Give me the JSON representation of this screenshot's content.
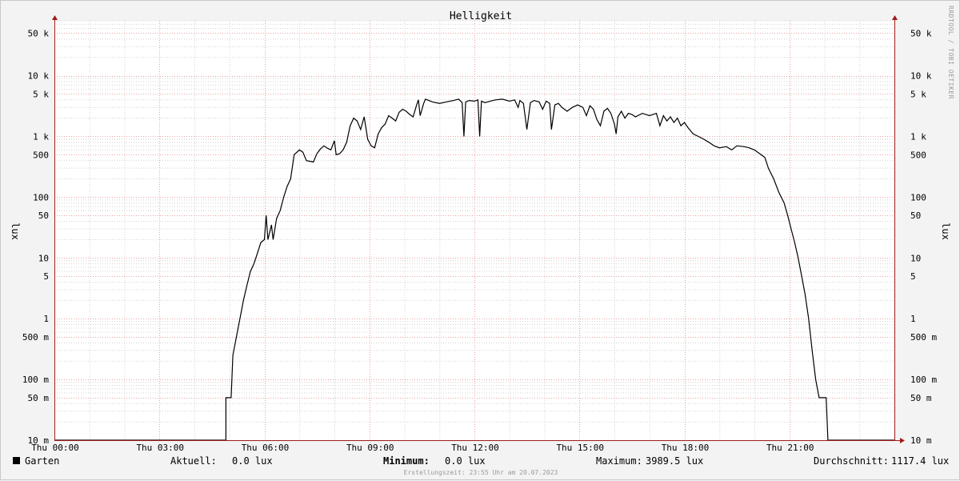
{
  "chart_data": {
    "type": "line",
    "title": "Helligkeit",
    "ylabel_left": "lux",
    "ylabel_right": "lux",
    "y_scale": "log",
    "ylim": [
      0.01,
      80000
    ],
    "xlim_hours": [
      0,
      24
    ],
    "x_ticks": [
      {
        "hour": 0,
        "label": "Thu 00:00"
      },
      {
        "hour": 3,
        "label": "Thu 03:00"
      },
      {
        "hour": 6,
        "label": "Thu 06:00"
      },
      {
        "hour": 9,
        "label": "Thu 09:00"
      },
      {
        "hour": 12,
        "label": "Thu 12:00"
      },
      {
        "hour": 15,
        "label": "Thu 15:00"
      },
      {
        "hour": 18,
        "label": "Thu 18:00"
      },
      {
        "hour": 21,
        "label": "Thu 21:00"
      }
    ],
    "y_ticks": [
      {
        "value": 0.01,
        "label": "10 m"
      },
      {
        "value": 0.05,
        "label": "50 m"
      },
      {
        "value": 0.1,
        "label": "100 m"
      },
      {
        "value": 0.5,
        "label": "500 m"
      },
      {
        "value": 1,
        "label": "1"
      },
      {
        "value": 5,
        "label": "5"
      },
      {
        "value": 10,
        "label": "10"
      },
      {
        "value": 50,
        "label": "50"
      },
      {
        "value": 100,
        "label": "100"
      },
      {
        "value": 500,
        "label": "500"
      },
      {
        "value": 1000,
        "label": "1 k"
      },
      {
        "value": 5000,
        "label": "5 k"
      },
      {
        "value": 10000,
        "label": "10 k"
      },
      {
        "value": 50000,
        "label": "50 k"
      }
    ],
    "grid": true,
    "colors": {
      "line": "#000000",
      "major_grid": "#e8a3a3",
      "minor_grid": "#d4d4d4",
      "axis": "#a11b1b",
      "plot_bg": "#ffffff"
    },
    "series": [
      {
        "name": "Garten",
        "points": [
          [
            0,
            0.01
          ],
          [
            4.9,
            0.01
          ],
          [
            4.9,
            0.05
          ],
          [
            5.05,
            0.05
          ],
          [
            5.1,
            0.25
          ],
          [
            5.2,
            0.5
          ],
          [
            5.3,
            1
          ],
          [
            5.4,
            2
          ],
          [
            5.5,
            3.5
          ],
          [
            5.6,
            6
          ],
          [
            5.7,
            8
          ],
          [
            5.8,
            12
          ],
          [
            5.9,
            18
          ],
          [
            6.0,
            20
          ],
          [
            6.05,
            50
          ],
          [
            6.1,
            20
          ],
          [
            6.2,
            35
          ],
          [
            6.25,
            20
          ],
          [
            6.35,
            45
          ],
          [
            6.45,
            60
          ],
          [
            6.55,
            100
          ],
          [
            6.65,
            150
          ],
          [
            6.75,
            200
          ],
          [
            6.85,
            500
          ],
          [
            7.0,
            600
          ],
          [
            7.1,
            550
          ],
          [
            7.2,
            400
          ],
          [
            7.4,
            380
          ],
          [
            7.5,
            520
          ],
          [
            7.6,
            620
          ],
          [
            7.7,
            700
          ],
          [
            7.8,
            640
          ],
          [
            7.9,
            600
          ],
          [
            8.0,
            850
          ],
          [
            8.05,
            500
          ],
          [
            8.15,
            520
          ],
          [
            8.25,
            600
          ],
          [
            8.35,
            800
          ],
          [
            8.45,
            1500
          ],
          [
            8.55,
            2000
          ],
          [
            8.65,
            1800
          ],
          [
            8.75,
            1300
          ],
          [
            8.85,
            2100
          ],
          [
            8.95,
            900
          ],
          [
            9.05,
            700
          ],
          [
            9.15,
            650
          ],
          [
            9.25,
            1100
          ],
          [
            9.35,
            1400
          ],
          [
            9.45,
            1600
          ],
          [
            9.55,
            2200
          ],
          [
            9.65,
            2000
          ],
          [
            9.75,
            1800
          ],
          [
            9.85,
            2500
          ],
          [
            9.95,
            2800
          ],
          [
            10.05,
            2600
          ],
          [
            10.15,
            2300
          ],
          [
            10.25,
            2100
          ],
          [
            10.35,
            3300
          ],
          [
            10.4,
            4000
          ],
          [
            10.45,
            2200
          ],
          [
            10.55,
            3500
          ],
          [
            10.6,
            4100
          ],
          [
            10.8,
            3700
          ],
          [
            11.0,
            3500
          ],
          [
            11.2,
            3700
          ],
          [
            11.4,
            3900
          ],
          [
            11.55,
            4100
          ],
          [
            11.65,
            3600
          ],
          [
            11.7,
            1000
          ],
          [
            11.75,
            3700
          ],
          [
            11.85,
            3900
          ],
          [
            12.0,
            3800
          ],
          [
            12.1,
            4000
          ],
          [
            12.15,
            1000
          ],
          [
            12.2,
            3800
          ],
          [
            12.3,
            3600
          ],
          [
            12.45,
            3800
          ],
          [
            12.6,
            4000
          ],
          [
            12.8,
            4100
          ],
          [
            13.0,
            3800
          ],
          [
            13.15,
            4000
          ],
          [
            13.25,
            3000
          ],
          [
            13.3,
            3900
          ],
          [
            13.4,
            3500
          ],
          [
            13.5,
            1300
          ],
          [
            13.6,
            3600
          ],
          [
            13.7,
            3900
          ],
          [
            13.85,
            3700
          ],
          [
            13.95,
            2800
          ],
          [
            14.05,
            3800
          ],
          [
            14.15,
            3500
          ],
          [
            14.2,
            1300
          ],
          [
            14.3,
            3300
          ],
          [
            14.4,
            3500
          ],
          [
            14.5,
            3000
          ],
          [
            14.65,
            2600
          ],
          [
            14.8,
            3000
          ],
          [
            14.95,
            3300
          ],
          [
            15.1,
            3000
          ],
          [
            15.2,
            2200
          ],
          [
            15.3,
            3200
          ],
          [
            15.4,
            2800
          ],
          [
            15.5,
            1900
          ],
          [
            15.6,
            1500
          ],
          [
            15.7,
            2600
          ],
          [
            15.8,
            2900
          ],
          [
            15.9,
            2400
          ],
          [
            16.0,
            1600
          ],
          [
            16.05,
            1100
          ],
          [
            16.1,
            2100
          ],
          [
            16.2,
            2600
          ],
          [
            16.3,
            2000
          ],
          [
            16.4,
            2400
          ],
          [
            16.5,
            2300
          ],
          [
            16.6,
            2100
          ],
          [
            16.8,
            2400
          ],
          [
            17.0,
            2200
          ],
          [
            17.2,
            2400
          ],
          [
            17.3,
            1500
          ],
          [
            17.4,
            2200
          ],
          [
            17.5,
            1800
          ],
          [
            17.6,
            2100
          ],
          [
            17.7,
            1700
          ],
          [
            17.8,
            2000
          ],
          [
            17.9,
            1500
          ],
          [
            18.0,
            1700
          ],
          [
            18.1,
            1400
          ],
          [
            18.25,
            1100
          ],
          [
            18.4,
            1000
          ],
          [
            18.55,
            900
          ],
          [
            18.7,
            800
          ],
          [
            18.85,
            700
          ],
          [
            19.0,
            650
          ],
          [
            19.2,
            680
          ],
          [
            19.35,
            600
          ],
          [
            19.5,
            700
          ],
          [
            19.7,
            680
          ],
          [
            19.85,
            650
          ],
          [
            20.0,
            600
          ],
          [
            20.15,
            520
          ],
          [
            20.3,
            450
          ],
          [
            20.4,
            300
          ],
          [
            20.55,
            200
          ],
          [
            20.7,
            120
          ],
          [
            20.85,
            80
          ],
          [
            20.95,
            50
          ],
          [
            21.05,
            30
          ],
          [
            21.15,
            18
          ],
          [
            21.25,
            10
          ],
          [
            21.35,
            5
          ],
          [
            21.45,
            2.5
          ],
          [
            21.55,
            1
          ],
          [
            21.65,
            0.3
          ],
          [
            21.75,
            0.1
          ],
          [
            21.85,
            0.05
          ],
          [
            22.05,
            0.05
          ],
          [
            22.1,
            0.01
          ],
          [
            24,
            0.01
          ]
        ]
      }
    ]
  },
  "legend": {
    "series_name": "Garten",
    "current_label": "Aktuell:",
    "current_value": "0.0 lux",
    "min_label": "Minimum:",
    "min_value": "0.0 lux",
    "max_label": "Maximum:",
    "max_value": "3989.5 lux",
    "avg_label": "Durchschnitt:",
    "avg_value": "1117.4 lux"
  },
  "footer": "Erstellungszeit: 23:55 Uhr am 20.07.2023",
  "side_text": "RRDTOOL / TOBI OETIKER"
}
